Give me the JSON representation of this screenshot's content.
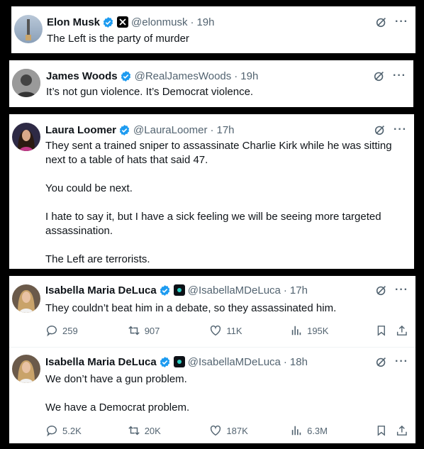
{
  "tweets": [
    {
      "name": "Elon Musk",
      "handle": "@elonmusk",
      "time": "19h",
      "text": [
        "The Left is the party of murder"
      ]
    },
    {
      "name": "James Woods",
      "handle": "@RealJamesWoods",
      "time": "19h",
      "text": [
        "It’s not gun violence. It’s Democrat violence."
      ]
    },
    {
      "name": "Laura Loomer",
      "handle": "@LauraLoomer",
      "time": "17h",
      "text": [
        "They sent a trained sniper to assassinate Charlie Kirk while he was sitting next to a table of hats that said 47.",
        "You could be next.",
        "I hate to say it, but I have a sick feeling we will be seeing more targeted assassination.",
        "The Left are terrorists."
      ]
    },
    {
      "name": "Isabella Maria DeLuca",
      "handle": "@IsabellaMDeLuca",
      "time": "17h",
      "text": [
        "They couldn’t beat him in a debate, so they assassinated him."
      ],
      "replies": "259",
      "reposts": "907",
      "likes": "11K",
      "views": "195K"
    },
    {
      "name": "Isabella Maria DeLuca",
      "handle": "@IsabellaMDeLuca",
      "time": "18h",
      "text": [
        "We don’t have a gun problem.",
        "We have a Democrat problem."
      ],
      "replies": "5.2K",
      "reposts": "20K",
      "likes": "187K",
      "views": "6.3M"
    }
  ],
  "separator_dot": "·",
  "more_glyph": "···",
  "colors": {
    "verified": "#1d9bf0",
    "muted": "#536471",
    "text": "#0f1419"
  }
}
